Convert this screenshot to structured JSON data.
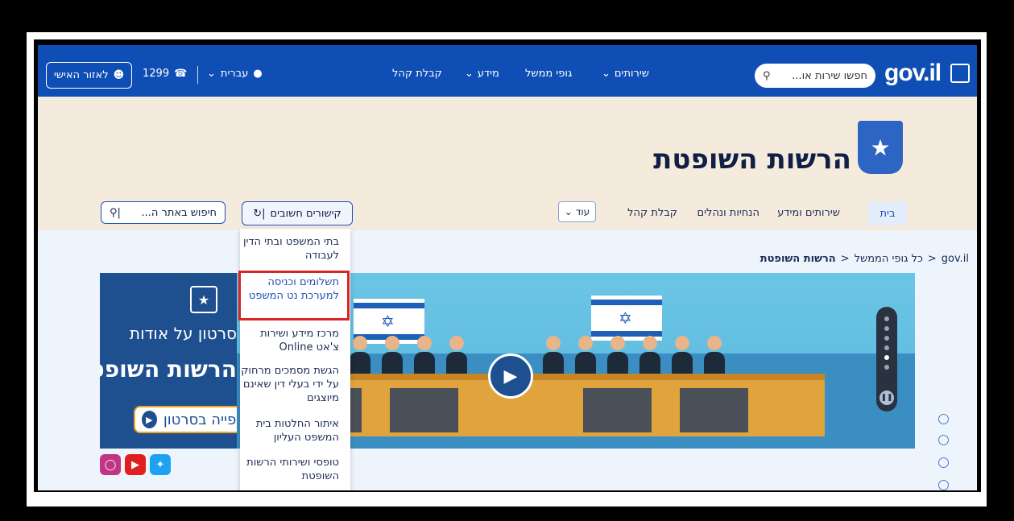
{
  "topnav": {
    "my_area": "לאזור האישי",
    "phone": "1299",
    "language": "עברית",
    "items": [
      "קבלת קהל",
      "מידע",
      "גופי ממשל",
      "שירותים"
    ],
    "search_placeholder": "חפשו שירות או...",
    "logo": "gov.il"
  },
  "header": {
    "title": "הרשות השופטת",
    "subnav": [
      "בית",
      "שירותים ומידע",
      "הנחיות ונהלים",
      "קבלת קהל",
      "עוד"
    ],
    "links_button": "קישורים חשובים",
    "site_search_placeholder": "חיפוש באתר ה..."
  },
  "breadcrumb": [
    "gov.il",
    "כל גופי הממשל",
    "הרשות השופטת"
  ],
  "dropdown": {
    "items": [
      "בתי המשפט ובתי הדין לעבודה",
      "תשלומים וכניסה למערכת נט המשפט",
      "מרכז מידע ושירות צ'אט Online",
      "הגשת מסמכים מרחוק על ידי בעלי דין שאינם מיוצגים",
      "איתור החלטות בית המשפט העליון",
      "טופסי ושירותי הרשות השופטת"
    ]
  },
  "hero": {
    "line1": "סרטון על אודות",
    "line2": "הרשות השופטת",
    "cta": "צפייה בסרטון"
  },
  "colors": {
    "nav_blue": "#0f4fb5",
    "header_beige": "#f5ebdd",
    "highlight_red": "#d72626"
  }
}
